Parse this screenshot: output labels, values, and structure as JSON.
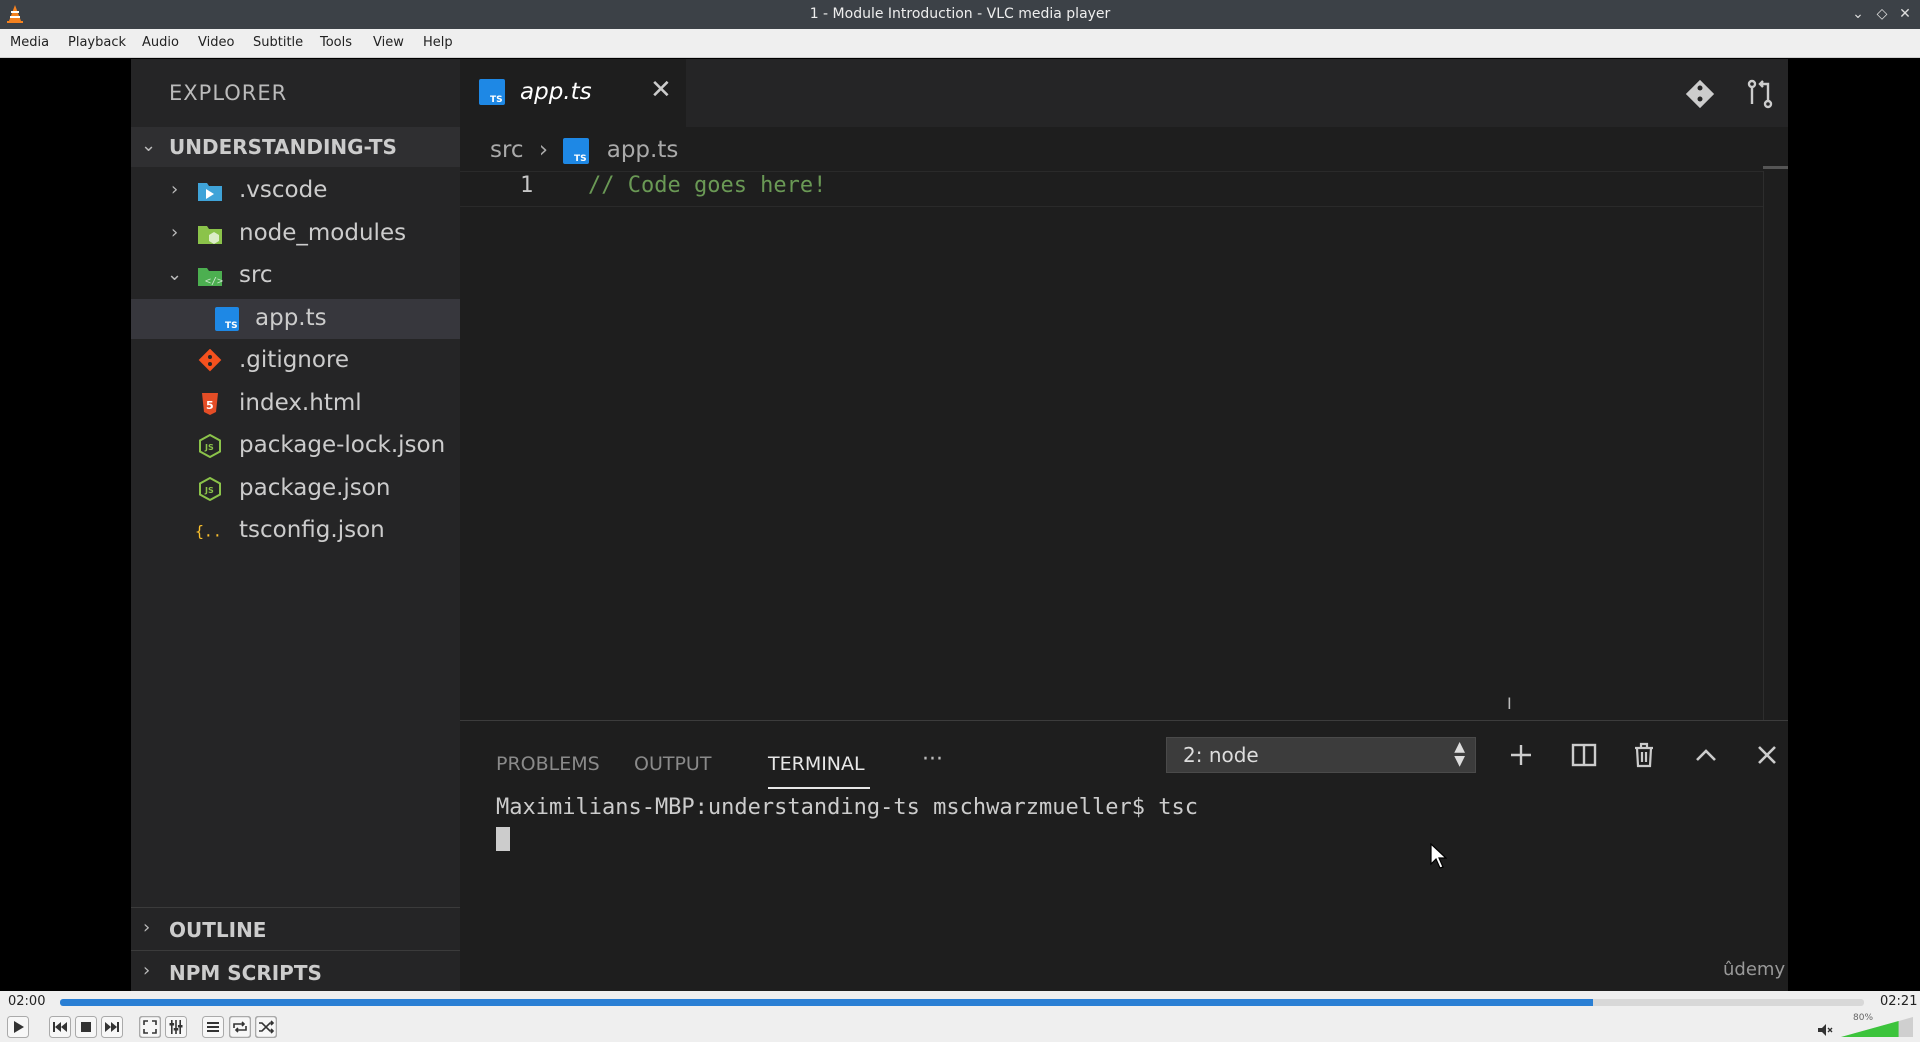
{
  "window": {
    "title": "1 - Module Introduction - VLC media player"
  },
  "menu": {
    "items": [
      "Media",
      "Playback",
      "Audio",
      "Video",
      "Subtitle",
      "Tools",
      "View",
      "Help"
    ]
  },
  "vscode": {
    "explorer_header": "EXPLORER",
    "project_name": "UNDERSTANDING-TS",
    "tree": [
      {
        "name": ".vscode",
        "icon": "vscode-folder-icon"
      },
      {
        "name": "node_modules",
        "icon": "node-folder-icon"
      },
      {
        "name": "src",
        "icon": "src-folder-icon"
      },
      {
        "name": "app.ts",
        "icon": "typescript-file-icon"
      },
      {
        "name": ".gitignore",
        "icon": "git-file-icon"
      },
      {
        "name": "index.html",
        "icon": "html5-file-icon"
      },
      {
        "name": "package-lock.json",
        "icon": "node-js-file-icon"
      },
      {
        "name": "package.json",
        "icon": "node-js-file-icon"
      },
      {
        "name": "tsconfig.json",
        "icon": "json-braces-icon"
      }
    ],
    "sections": [
      "OUTLINE",
      "NPM SCRIPTS"
    ],
    "tab_name": "app.ts",
    "breadcrumb": {
      "folder": "src",
      "file": "app.ts"
    },
    "code": {
      "line_number": "1",
      "text": "// Code goes here!"
    },
    "panel": {
      "tabs": [
        "PROBLEMS",
        "OUTPUT",
        "TERMINAL"
      ],
      "more": "···",
      "terminal_select": "2: node",
      "terminal_line": "Maximilians-MBP:understanding-ts mschwarzmueller$ tsc"
    },
    "watermark": "ûdemy",
    "colors": {
      "ts_blue": "#1e88e5",
      "accent": "#2a7fd4"
    }
  },
  "player": {
    "time_current": "02:00",
    "time_total": "02:21",
    "progress": 0.85,
    "volume_label": "80%",
    "volume": 0.8
  }
}
